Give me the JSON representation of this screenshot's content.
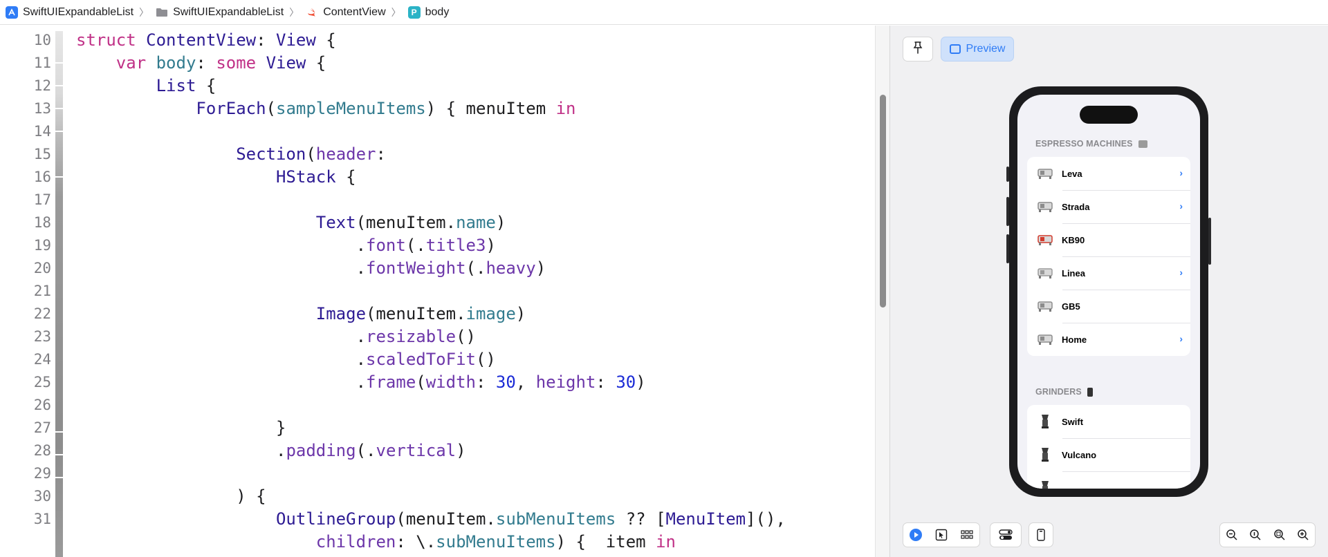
{
  "breadcrumb": [
    {
      "label": "SwiftUIExpandableList",
      "icon": "xcode-app-icon"
    },
    {
      "label": "SwiftUIExpandableList",
      "icon": "folder-icon"
    },
    {
      "label": "ContentView",
      "icon": "swift-file-icon"
    },
    {
      "label": "body",
      "icon": "property-icon",
      "icon_letter": "P"
    }
  ],
  "editor": {
    "line_numbers": [
      "10",
      "11",
      "12",
      "13",
      "14",
      "15",
      "16",
      "17",
      "18",
      "19",
      "20",
      "21",
      "22",
      "23",
      "24",
      "25",
      "26",
      "27",
      "28",
      "29",
      "30",
      "31"
    ],
    "lines": [
      [
        [
          "kw",
          "struct"
        ],
        [
          "pl",
          " "
        ],
        [
          "ty",
          "ContentView"
        ],
        [
          "pl",
          ": "
        ],
        [
          "ty",
          "View"
        ],
        [
          "pl",
          " {"
        ]
      ],
      [
        [
          "pl",
          "    "
        ],
        [
          "kw",
          "var"
        ],
        [
          "pl",
          " "
        ],
        [
          "pr",
          "body"
        ],
        [
          "pl",
          ": "
        ],
        [
          "kw",
          "some"
        ],
        [
          "pl",
          " "
        ],
        [
          "ty",
          "View"
        ],
        [
          "pl",
          " {"
        ]
      ],
      [
        [
          "pl",
          "        "
        ],
        [
          "ty",
          "List"
        ],
        [
          "pl",
          " {"
        ]
      ],
      [
        [
          "pl",
          "            "
        ],
        [
          "ty",
          "ForEach"
        ],
        [
          "pl",
          "("
        ],
        [
          "pr",
          "sampleMenuItems"
        ],
        [
          "pl",
          ") { menuItem "
        ],
        [
          "kw",
          "in"
        ]
      ],
      [],
      [
        [
          "pl",
          "                "
        ],
        [
          "ty",
          "Section"
        ],
        [
          "pl",
          "("
        ],
        [
          "fn",
          "header"
        ],
        [
          "pl",
          ":"
        ]
      ],
      [
        [
          "pl",
          "                    "
        ],
        [
          "ty",
          "HStack"
        ],
        [
          "pl",
          " {"
        ]
      ],
      [],
      [
        [
          "pl",
          "                        "
        ],
        [
          "ty",
          "Text"
        ],
        [
          "pl",
          "(menuItem."
        ],
        [
          "pr",
          "name"
        ],
        [
          "pl",
          ")"
        ]
      ],
      [
        [
          "pl",
          "                            ."
        ],
        [
          "fn",
          "font"
        ],
        [
          "pl",
          "(."
        ],
        [
          "fn",
          "title3"
        ],
        [
          "pl",
          ")"
        ]
      ],
      [
        [
          "pl",
          "                            ."
        ],
        [
          "fn",
          "fontWeight"
        ],
        [
          "pl",
          "(."
        ],
        [
          "fn",
          "heavy"
        ],
        [
          "pl",
          ")"
        ]
      ],
      [],
      [
        [
          "pl",
          "                        "
        ],
        [
          "ty",
          "Image"
        ],
        [
          "pl",
          "(menuItem."
        ],
        [
          "pr",
          "image"
        ],
        [
          "pl",
          ")"
        ]
      ],
      [
        [
          "pl",
          "                            ."
        ],
        [
          "fn",
          "resizable"
        ],
        [
          "pl",
          "()"
        ]
      ],
      [
        [
          "pl",
          "                            ."
        ],
        [
          "fn",
          "scaledToFit"
        ],
        [
          "pl",
          "()"
        ]
      ],
      [
        [
          "pl",
          "                            ."
        ],
        [
          "fn",
          "frame"
        ],
        [
          "pl",
          "("
        ],
        [
          "fn",
          "width"
        ],
        [
          "pl",
          ": "
        ],
        [
          "nm",
          "30"
        ],
        [
          "pl",
          ", "
        ],
        [
          "fn",
          "height"
        ],
        [
          "pl",
          ": "
        ],
        [
          "nm",
          "30"
        ],
        [
          "pl",
          ")"
        ]
      ],
      [],
      [
        [
          "pl",
          "                    }"
        ]
      ],
      [
        [
          "pl",
          "                    ."
        ],
        [
          "fn",
          "padding"
        ],
        [
          "pl",
          "(."
        ],
        [
          "fn",
          "vertical"
        ],
        [
          "pl",
          ")"
        ]
      ],
      [],
      [
        [
          "pl",
          "                ) {"
        ]
      ],
      [
        [
          "pl",
          "                    "
        ],
        [
          "ty",
          "OutlineGroup"
        ],
        [
          "pl",
          "(menuItem."
        ],
        [
          "pr",
          "subMenuItems"
        ],
        [
          "pl",
          " ?? ["
        ],
        [
          "ty",
          "MenuItem"
        ],
        [
          "pl",
          "](),"
        ]
      ],
      [
        [
          "pl",
          "                        "
        ],
        [
          "fn",
          "children"
        ],
        [
          "pl",
          ": \\."
        ],
        [
          "pr",
          "subMenuItems"
        ],
        [
          "pl",
          ") {  item "
        ],
        [
          "kw",
          "in"
        ]
      ]
    ]
  },
  "preview": {
    "preview_label": "Preview",
    "sections": [
      {
        "header": "ESPRESSO MACHINES",
        "rows": [
          {
            "label": "Leva",
            "expandable": true
          },
          {
            "label": "Strada",
            "expandable": true
          },
          {
            "label": "KB90",
            "expandable": false
          },
          {
            "label": "Linea",
            "expandable": true
          },
          {
            "label": "GB5",
            "expandable": false
          },
          {
            "label": "Home",
            "expandable": true
          }
        ]
      },
      {
        "header": "GRINDERS",
        "rows": [
          {
            "label": "Swift",
            "expandable": false
          },
          {
            "label": "Vulcano",
            "expandable": false
          },
          {
            "label": "",
            "expandable": false
          }
        ]
      }
    ],
    "bottom_toolbar": {
      "left_group": [
        "play-icon",
        "select-icon",
        "grid-icon"
      ],
      "variants_icon": "variants-icon",
      "device_icon": "device-icon",
      "zoom_group": [
        "zoom-out-icon",
        "zoom-fit-icon",
        "zoom-actual-icon",
        "zoom-in-icon"
      ]
    }
  },
  "colors": {
    "keyword": "#c03187",
    "type": "#2d1b93",
    "function": "#6c36a9",
    "property": "#327b8e",
    "number": "#1b2bd6",
    "accent": "#2f7cf6"
  }
}
